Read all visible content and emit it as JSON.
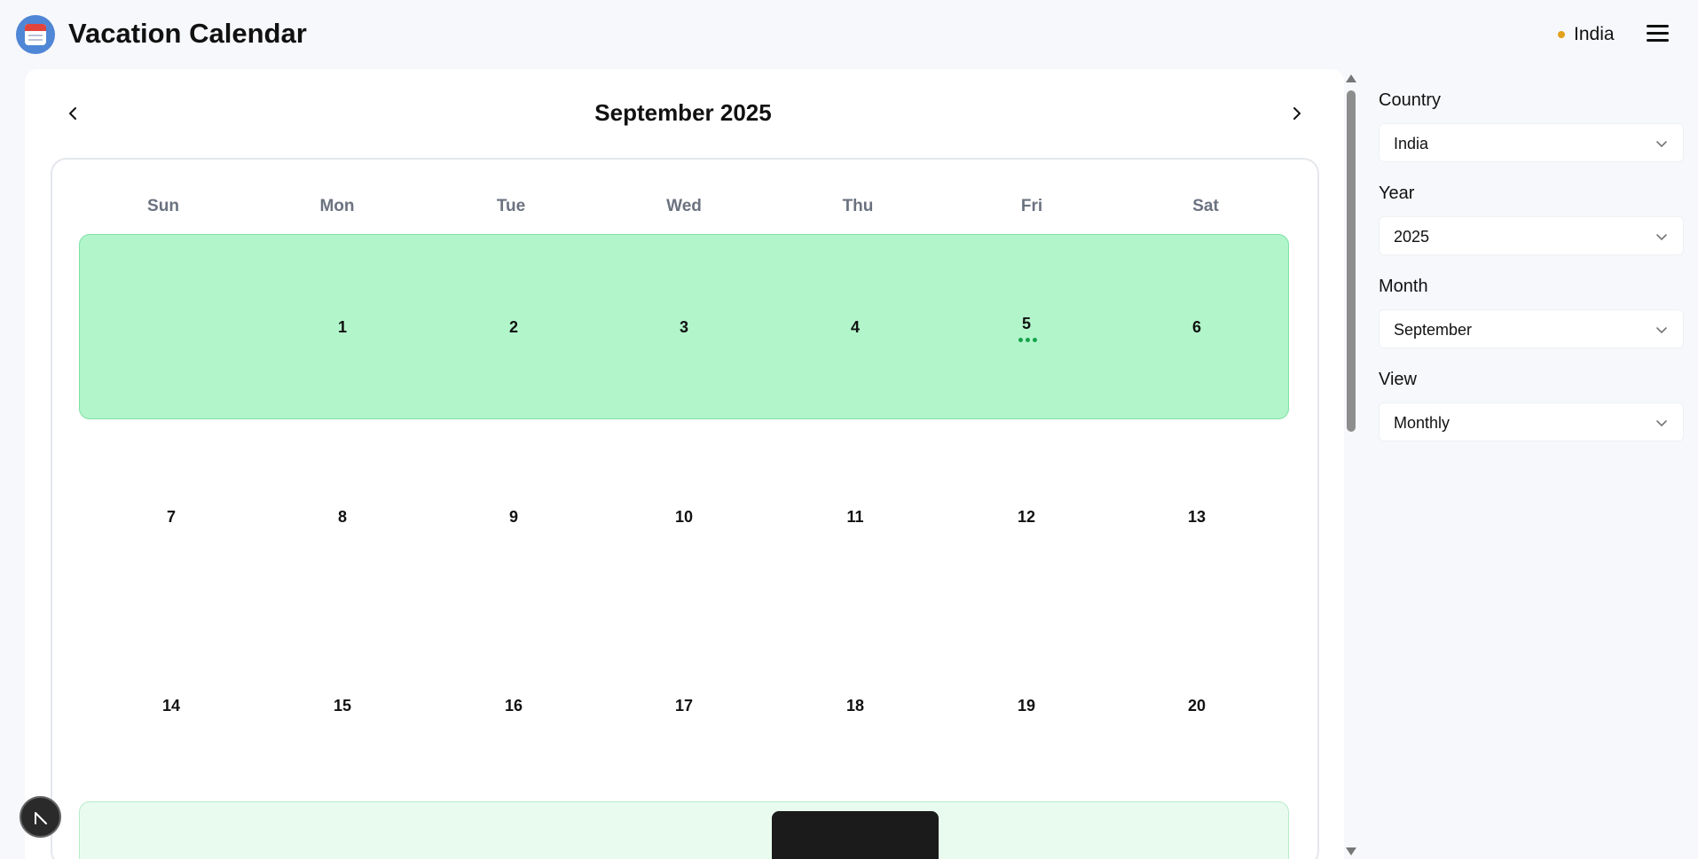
{
  "header": {
    "app_title": "Vacation Calendar",
    "logo_icon": "calendar-icon",
    "selected_country": "India",
    "status_color": "#e3a01b",
    "menu_icon": "hamburger-menu-icon"
  },
  "calendar": {
    "month_title": "September 2025",
    "prev_icon": "chevron-left-icon",
    "next_icon": "chevron-right-icon",
    "weekdays": [
      "Sun",
      "Mon",
      "Tue",
      "Wed",
      "Thu",
      "Fri",
      "Sat"
    ],
    "weeks": [
      [
        "",
        "1",
        "2",
        "3",
        "4",
        "5",
        "6"
      ],
      [
        "7",
        "8",
        "9",
        "10",
        "11",
        "12",
        "13"
      ],
      [
        "14",
        "15",
        "16",
        "17",
        "18",
        "19",
        "20"
      ]
    ],
    "highlight_color": "#b2f5cb",
    "event_dot_color": "#16a34a"
  },
  "sidebar": {
    "country": {
      "label": "Country",
      "value": "India"
    },
    "year": {
      "label": "Year",
      "value": "2025"
    },
    "month": {
      "label": "Month",
      "value": "September"
    },
    "view": {
      "label": "View",
      "value": "Monthly"
    }
  },
  "fab": {
    "icon": "logo-n-icon"
  }
}
